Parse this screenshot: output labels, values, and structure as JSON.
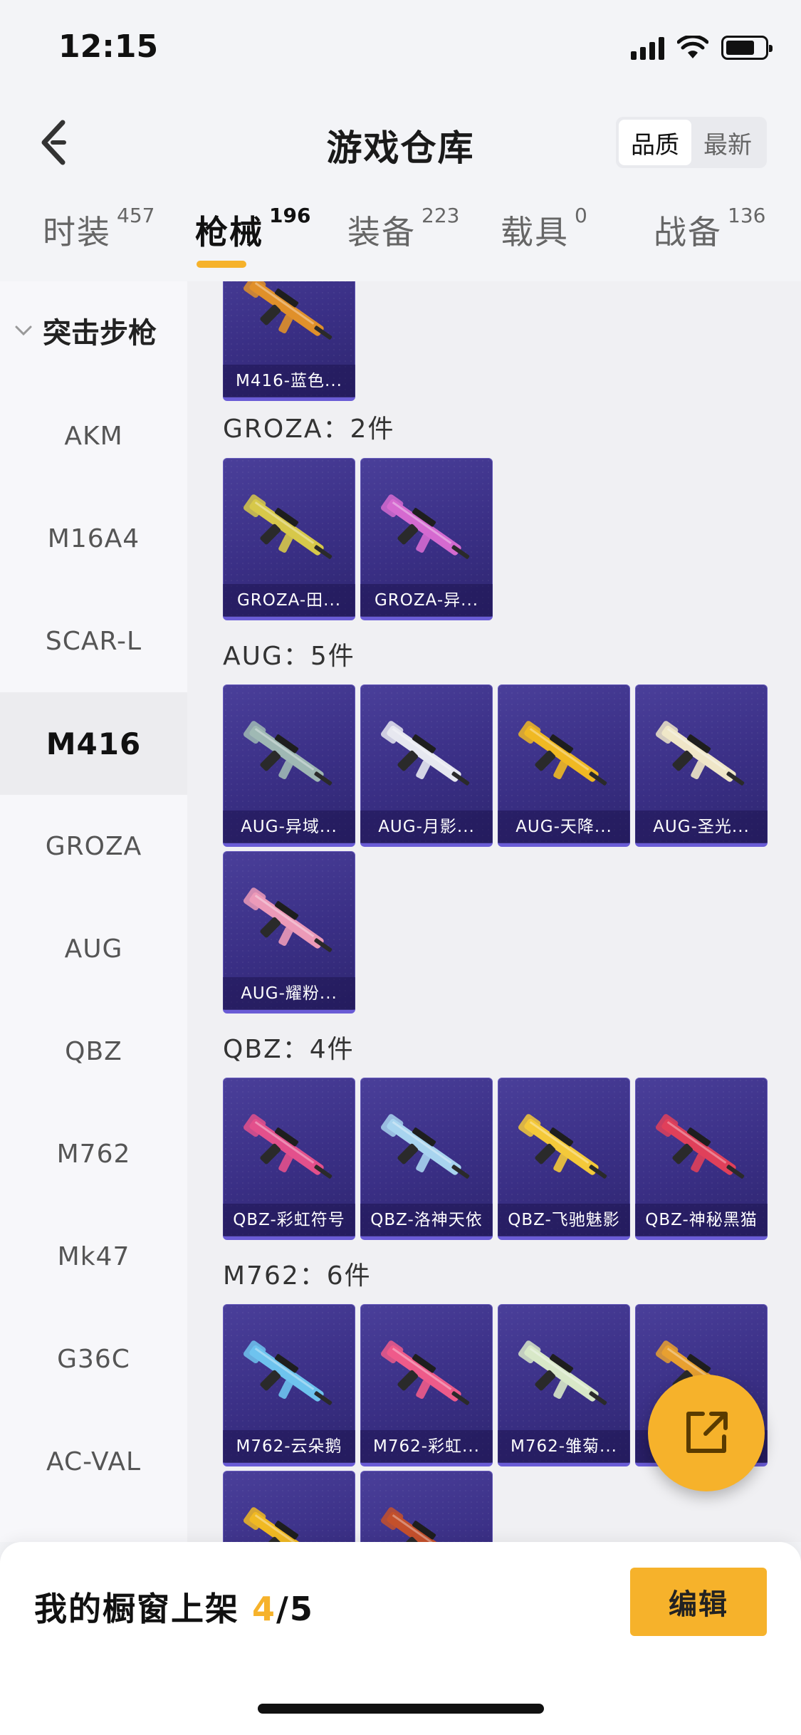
{
  "status_bar": {
    "time": "12:15"
  },
  "header": {
    "title": "游戏仓库",
    "sort_options": [
      {
        "label": "品质",
        "active": true
      },
      {
        "label": "最新",
        "active": false
      }
    ]
  },
  "category_tabs": [
    {
      "label": "时装",
      "count": "457",
      "active": false
    },
    {
      "label": "枪械",
      "count": "196",
      "active": true
    },
    {
      "label": "装备",
      "count": "223",
      "active": false
    },
    {
      "label": "载具",
      "count": "0",
      "active": false
    },
    {
      "label": "战备",
      "count": "136",
      "active": false
    }
  ],
  "sidebar": {
    "group_label": "突击步枪",
    "items": [
      {
        "label": "AKM",
        "active": false
      },
      {
        "label": "M16A4",
        "active": false
      },
      {
        "label": "SCAR-L",
        "active": false
      },
      {
        "label": "M416",
        "active": true
      },
      {
        "label": "GROZA",
        "active": false
      },
      {
        "label": "AUG",
        "active": false
      },
      {
        "label": "QBZ",
        "active": false
      },
      {
        "label": "M762",
        "active": false
      },
      {
        "label": "Mk47",
        "active": false
      },
      {
        "label": "G36C",
        "active": false
      },
      {
        "label": "AC-VAL",
        "active": false
      }
    ]
  },
  "content": {
    "top_card": {
      "label": "M416-蓝色...",
      "gun_color": "#e0902a"
    },
    "sections": [
      {
        "title": "GROZA：2件",
        "items": [
          {
            "label": "GROZA-田...",
            "gun_color": "#d7c84a"
          },
          {
            "label": "GROZA-异...",
            "gun_color": "#d56ad0"
          }
        ]
      },
      {
        "title": "AUG：5件",
        "items": [
          {
            "label": "AUG-异域...",
            "gun_color": "#9fb8b4"
          },
          {
            "label": "AUG-月影...",
            "gun_color": "#e6e8f0"
          },
          {
            "label": "AUG-天降...",
            "gun_color": "#f0b923"
          },
          {
            "label": "AUG-圣光...",
            "gun_color": "#efe6c8"
          },
          {
            "label": "AUG-耀粉...",
            "gun_color": "#ec9ab8"
          }
        ]
      },
      {
        "title": "QBZ：4件",
        "items": [
          {
            "label": "QBZ-彩虹符号",
            "gun_color": "#e3508c"
          },
          {
            "label": "QBZ-洛神天依",
            "gun_color": "#a8d4ef"
          },
          {
            "label": "QBZ-飞驰魅影",
            "gun_color": "#f4c93a"
          },
          {
            "label": "QBZ-神秘黑猫",
            "gun_color": "#e0405a"
          }
        ]
      },
      {
        "title": "M762：6件",
        "items": [
          {
            "label": "M762-云朵鹅",
            "gun_color": "#6ec3ee"
          },
          {
            "label": "M762-彩虹...",
            "gun_color": "#ee5b8a"
          },
          {
            "label": "M762-雏菊...",
            "gun_color": "#d8e8c8"
          },
          {
            "label": "",
            "gun_color": "#e8a030"
          },
          {
            "label": "",
            "gun_color": "#f0b923"
          },
          {
            "label": "",
            "gun_color": "#c4502c"
          }
        ]
      }
    ]
  },
  "bottom_bar": {
    "showcase_prefix": "我的橱窗上架 ",
    "showcase_count": "4",
    "showcase_total": "/5",
    "edit_label": "编辑"
  },
  "colors": {
    "accent": "#f6b22b",
    "card_bg": "#3a2f85",
    "card_border": "#6a5cd6"
  }
}
